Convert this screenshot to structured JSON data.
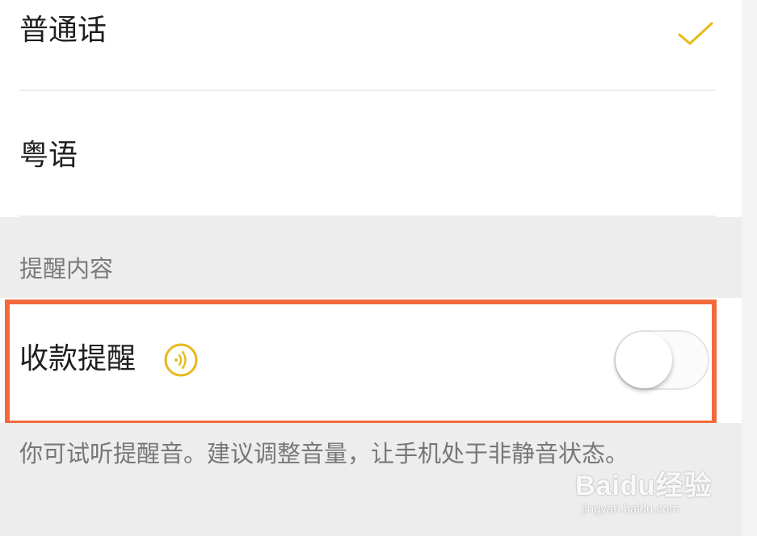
{
  "language_options": [
    {
      "label": "普通话",
      "selected": true
    },
    {
      "label": "粤语",
      "selected": false
    }
  ],
  "reminder_section": {
    "header": "提醒内容",
    "toggle_label": "收款提醒",
    "toggle_on": false,
    "sound_icon": "speaker-waves-icon"
  },
  "footer_note": "你可试听提醒音。建议调整音量，让手机处于非静音状态。",
  "colors": {
    "accent": "#e8b91a",
    "highlight_border": "#f26a3c",
    "section_bg": "#ededed"
  },
  "watermark": {
    "brand": "Baidu经验",
    "url": "jingyan.baidu.com"
  }
}
